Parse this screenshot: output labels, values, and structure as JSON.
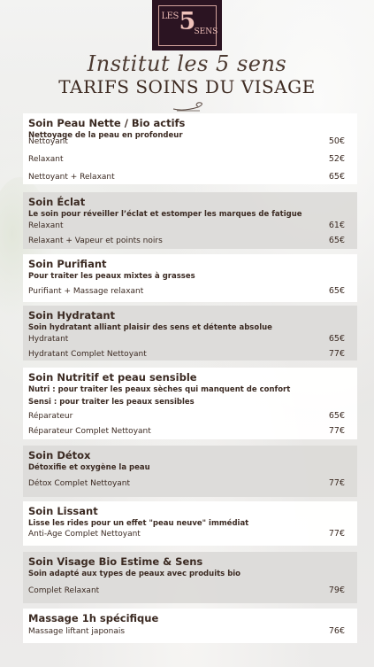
{
  "logo": {
    "les": "LES",
    "five": "5",
    "sens": "SENS"
  },
  "header": {
    "subtitle": "Institut les 5 sens",
    "title": "TARIFS SOINS DU VISAGE"
  },
  "cards": [
    {
      "title": "Soin Peau Nette / Bio actifs",
      "descriptions": [
        "Nettoyage de la peau en profondeur"
      ],
      "items": [
        {
          "label": "Nettoyant",
          "price": "50€"
        },
        {
          "label": "Relaxant",
          "price": "52€"
        },
        {
          "label": "Nettoyant + Relaxant",
          "price": "65€"
        }
      ]
    },
    {
      "title": "Soin Éclat",
      "descriptions": [
        "Le soin pour réveiller l’éclat et estomper les marques de fatigue"
      ],
      "items": [
        {
          "label": "Relaxant",
          "price": "61€"
        },
        {
          "label": "Relaxant + Vapeur et points noirs",
          "price": "65€"
        }
      ]
    },
    {
      "title": "Soin Purifiant",
      "descriptions": [
        "Pour traiter les peaux mixtes à grasses"
      ],
      "items": [
        {
          "label": "Purifiant + Massage relaxant",
          "price": "65€"
        }
      ]
    },
    {
      "title": "Soin Hydratant",
      "descriptions": [
        "Soin hydratant alliant plaisir des sens et détente absolue"
      ],
      "items": [
        {
          "label": "Hydratant",
          "price": "65€"
        },
        {
          "label": "Hydratant Complet Nettoyant",
          "price": "77€"
        }
      ]
    },
    {
      "title": "Soin Nutritif et peau sensible",
      "descriptions": [
        "Nutri : pour traiter les peaux sèches qui manquent de confort",
        "Sensi : pour traiter les peaux sensibles"
      ],
      "items": [
        {
          "label": "Réparateur",
          "price": "65€"
        },
        {
          "label": "Réparateur Complet Nettoyant",
          "price": "77€"
        }
      ]
    },
    {
      "title": "Soin Détox",
      "descriptions": [
        "Détoxifie et oxygène la peau"
      ],
      "items": [
        {
          "label": "Détox Complet Nettoyant",
          "price": "77€"
        }
      ]
    },
    {
      "title": "Soin Lissant",
      "descriptions": [
        "Lisse les rides pour un effet \"peau neuve\" immédiat"
      ],
      "items": [
        {
          "label": "Anti-Age Complet Nettoyant",
          "price": "77€"
        }
      ]
    },
    {
      "title": "Soin Visage Bio Estime & Sens",
      "descriptions": [
        "Soin adapté aux types de peaux avec produits bio"
      ],
      "items": [
        {
          "label": "Complet Relaxant",
          "price": "79€"
        }
      ]
    },
    {
      "title": "Massage 1h spécifique",
      "descriptions": [],
      "items": [
        {
          "label": "Massage liftant japonais",
          "price": "76€"
        }
      ]
    }
  ]
}
